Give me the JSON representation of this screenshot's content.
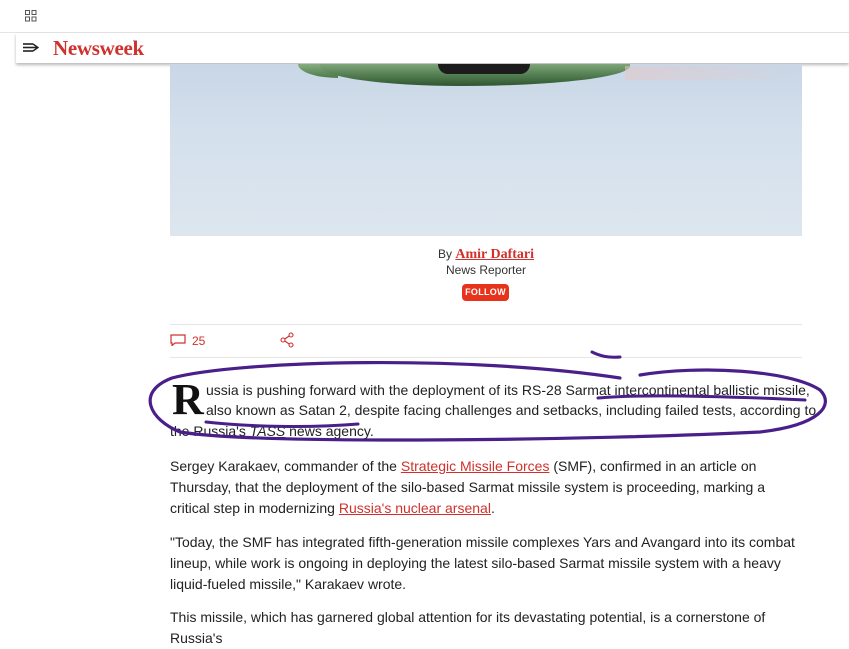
{
  "brand": {
    "name": "Newsweek",
    "accent": "#d0312d"
  },
  "icons": {
    "grid": "grid-icon",
    "menu": "menu-icon",
    "comment": "comment-icon",
    "share": "share-icon"
  },
  "byline": {
    "by": "By",
    "author": "Amir Daftari",
    "role": "News Reporter",
    "follow": "FOLLOW"
  },
  "social": {
    "comment_count": "25"
  },
  "lead": {
    "dropcap": "R",
    "line1": "ussia is pushing forward with the deployment of its RS-28 Sarmat intercontinental ballistic missile,",
    "line2": "also known as Satan 2, despite facing challenges and setbacks, including failed tests, according to",
    "line3_pre": "the Russia's ",
    "line3_italic": "TASS",
    "line3_post": " news agency."
  },
  "paragraphs": {
    "p1_pre": "Sergey Karakaev, commander of the ",
    "p1_link": "Strategic Missile Forces",
    "p1_mid": " (SMF), confirmed in an article on Thursday, that the deployment of the silo-based Sarmat missile system is proceeding, marking a critical step in modernizing ",
    "p1_link2": "Russia's nuclear arsenal",
    "p1_post": ".",
    "p2": "\"Today, the SMF has integrated fifth-generation missile complexes Yars and Avangard into its combat lineup, while work is ongoing in deploying the latest silo-based Sarmat missile system with a heavy liquid-fueled missile,\" Karakaev wrote.",
    "p3": "This missile, which has garnered global attention for its devastating potential, is a cornerstone of Russia's"
  },
  "annotation_color": "#4a1f8a"
}
